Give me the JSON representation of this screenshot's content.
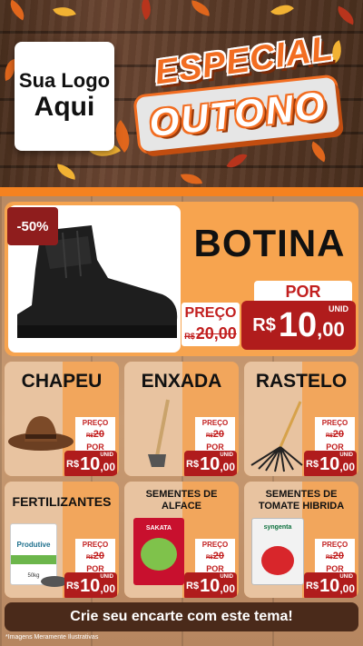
{
  "header": {
    "logo_line1": "Sua Logo",
    "logo_line2": "Aqui",
    "title_top": "ESPECIAL",
    "title_bottom": "OUTONO"
  },
  "hero": {
    "discount": "-50%",
    "name": "BOTINA",
    "preco_label": "PREÇO",
    "old_currency": "R$",
    "old_price": "20,00",
    "por_label": "POR",
    "unid_label": "UNID",
    "currency": "R$",
    "price_int": "10",
    "price_dec": ",00"
  },
  "products": [
    {
      "name": "CHAPEU",
      "preco_label": "PREÇO",
      "old_currency": "R$",
      "old_price": "20",
      "por_label": "POR",
      "unid_label": "UNID",
      "currency": "R$",
      "price_int": "10",
      "price_dec": ",00"
    },
    {
      "name": "ENXADA",
      "preco_label": "PREÇO",
      "old_currency": "R$",
      "old_price": "20",
      "por_label": "POR",
      "unid_label": "UNID",
      "currency": "R$",
      "price_int": "10",
      "price_dec": ",00"
    },
    {
      "name": "RASTELO",
      "preco_label": "PREÇO",
      "old_currency": "R$",
      "old_price": "20",
      "por_label": "POR",
      "unid_label": "UNID",
      "currency": "R$",
      "price_int": "10",
      "price_dec": ",00"
    },
    {
      "name": "FERTILIZANTES",
      "preco_label": "PREÇO",
      "old_currency": "R$",
      "old_price": "20",
      "por_label": "POR",
      "unid_label": "UNID",
      "currency": "R$",
      "price_int": "10",
      "price_dec": ",00",
      "package_text": "Produtive",
      "package_weight": "50kg"
    },
    {
      "name": "SEMENTES DE ALFACE",
      "preco_label": "PREÇO",
      "old_currency": "R$",
      "old_price": "20",
      "por_label": "POR",
      "unid_label": "UNID",
      "currency": "R$",
      "price_int": "10",
      "price_dec": ",00",
      "package_text": "SAKATA"
    },
    {
      "name": "SEMENTES DE TOMATE HIBRIDA",
      "preco_label": "PREÇO",
      "old_currency": "R$",
      "old_price": "20",
      "por_label": "POR",
      "unid_label": "UNID",
      "currency": "R$",
      "price_int": "10",
      "price_dec": ",00",
      "package_text": "syngenta"
    }
  ],
  "footer": {
    "cta": "Crie seu encarte com este tema!",
    "disclaimer": "*Imagens Meramente Ilustrativas"
  },
  "colors": {
    "accent_orange": "#f58220",
    "price_red": "#b01c1c",
    "wood_dark": "#4a2f1e",
    "cta_bg": "#4a2a1a"
  }
}
